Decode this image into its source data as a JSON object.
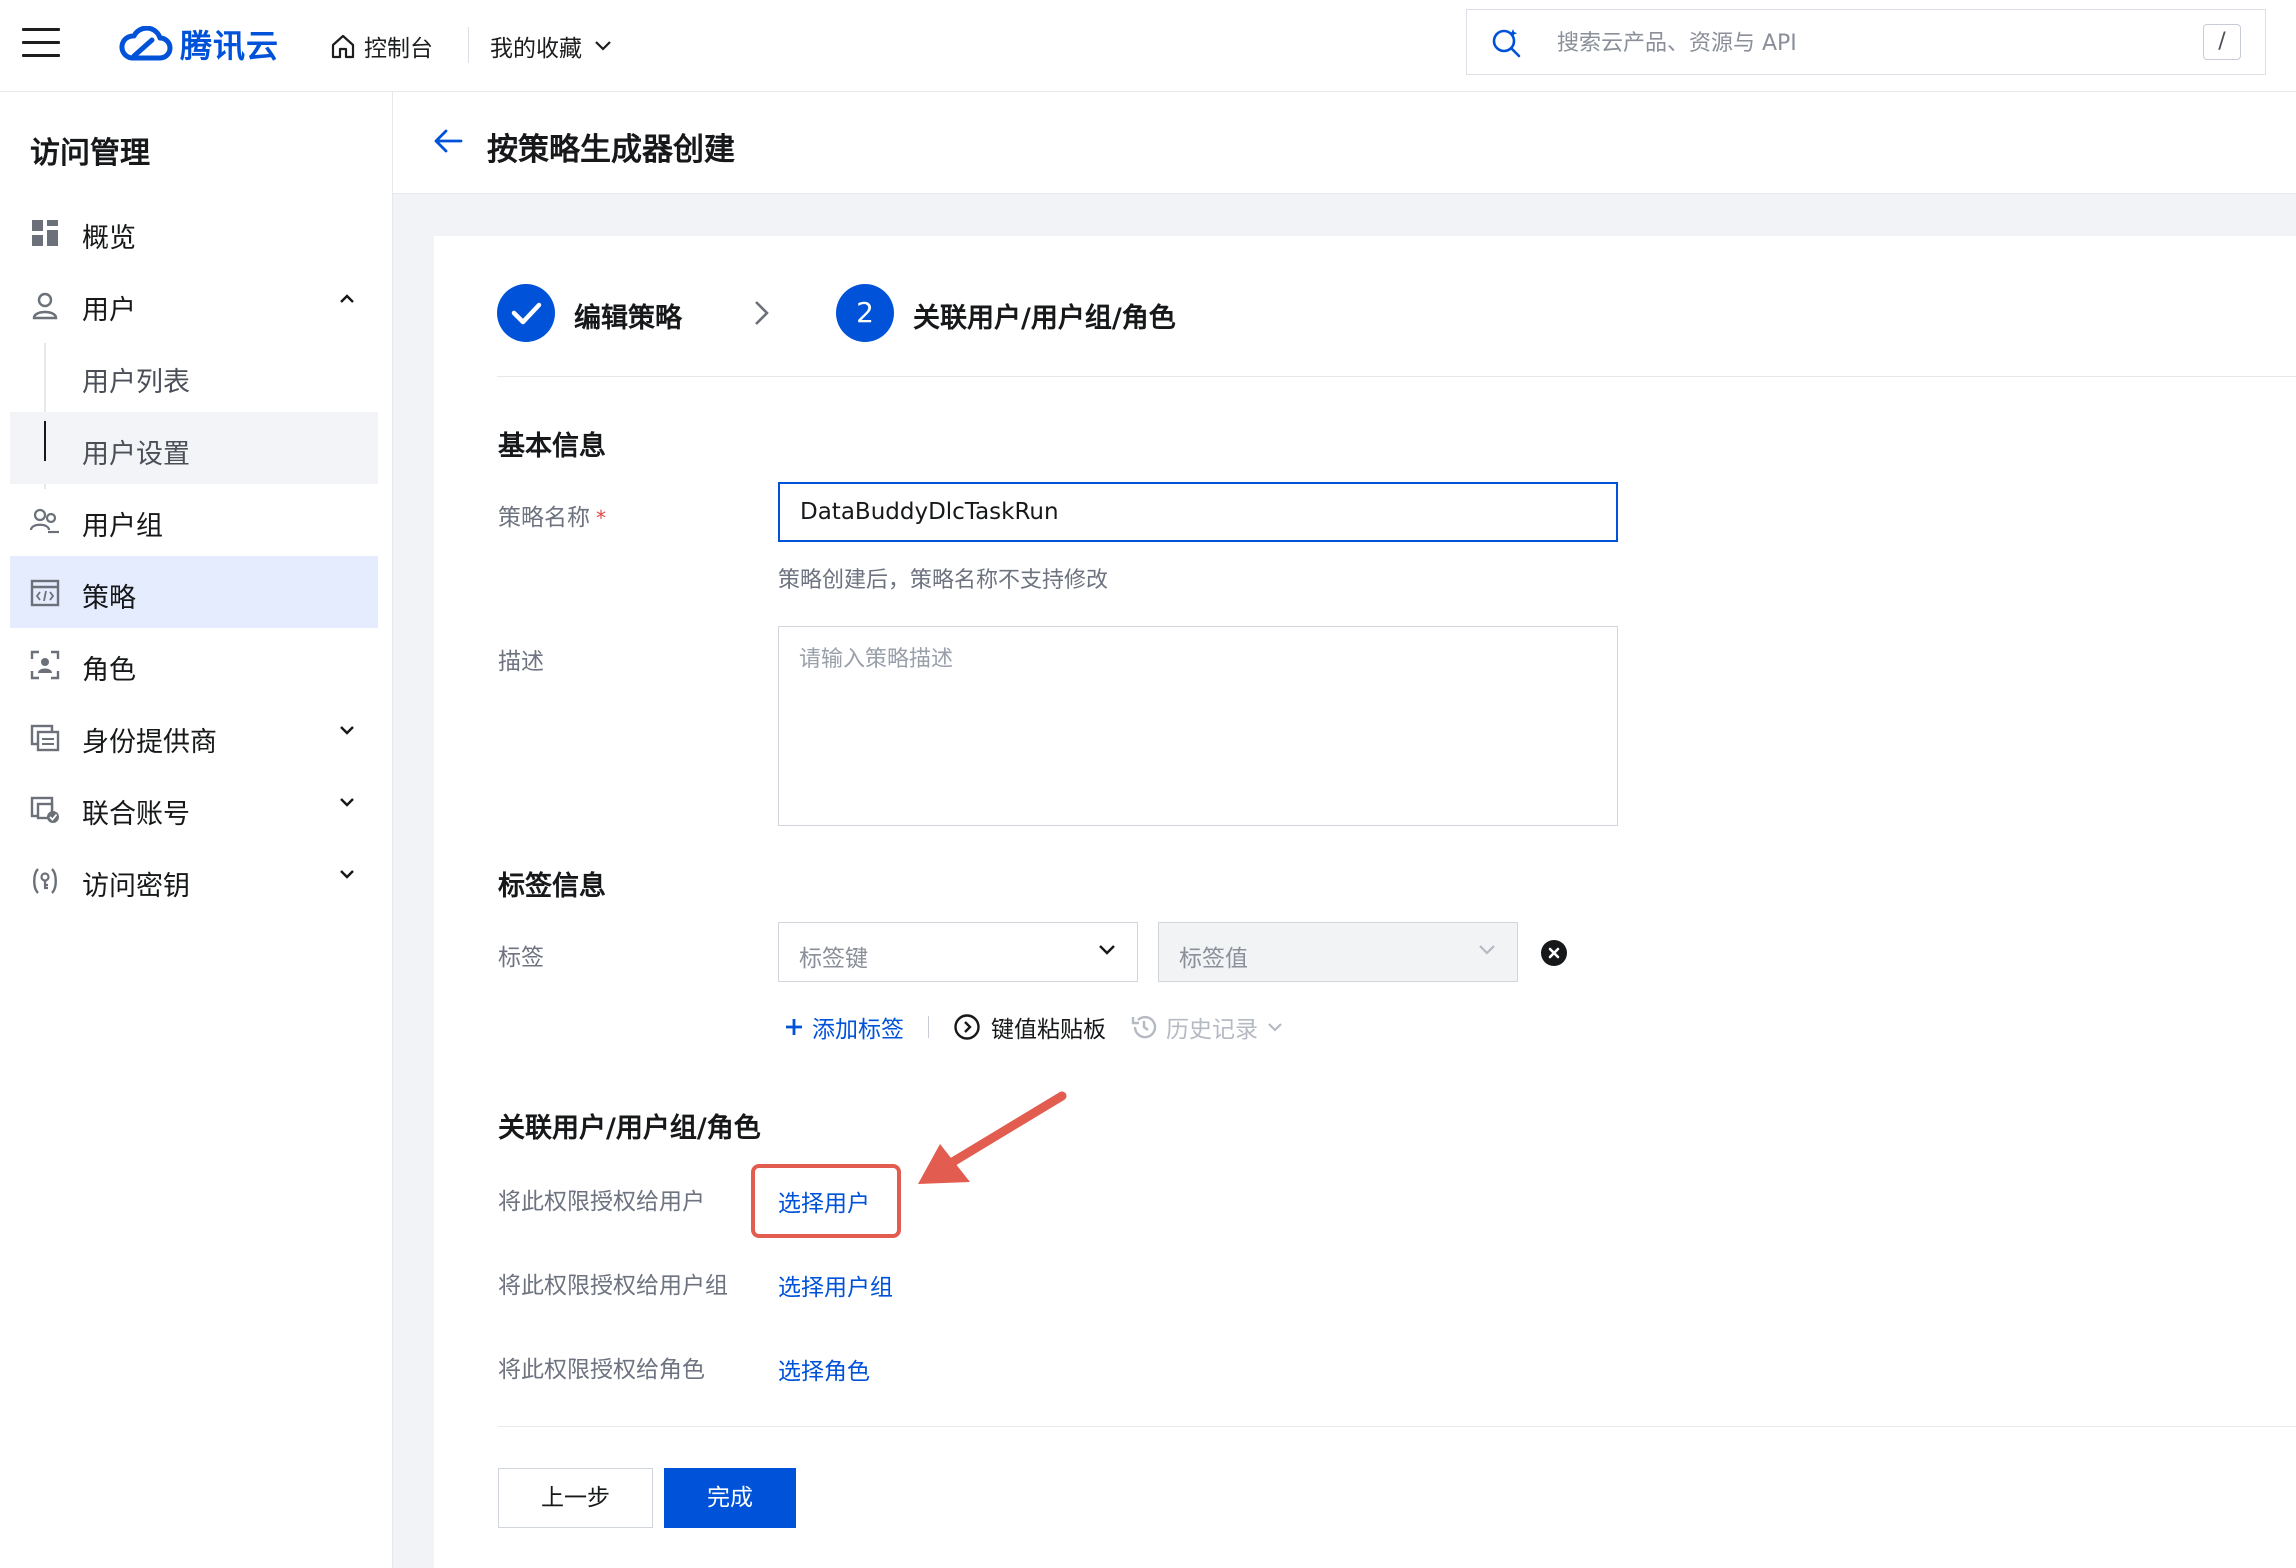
{
  "header": {
    "logo_text": "腾讯云",
    "console_label": "控制台",
    "favorites_label": "我的收藏",
    "search_placeholder": "搜索云产品、资源与 API",
    "search_shortcut": "/"
  },
  "sidebar": {
    "title": "访问管理",
    "items": [
      {
        "label": "概览",
        "icon": "grid-icon"
      },
      {
        "label": "用户",
        "icon": "user-icon",
        "expanded": true
      },
      {
        "label": "用户列表"
      },
      {
        "label": "用户设置",
        "selected": true
      },
      {
        "label": "用户组",
        "icon": "user-group-icon"
      },
      {
        "label": "策略",
        "icon": "policy-icon",
        "active": true
      },
      {
        "label": "角色",
        "icon": "role-icon"
      },
      {
        "label": "身份提供商",
        "icon": "identity-provider-icon"
      },
      {
        "label": "联合账号",
        "icon": "federated-account-icon"
      },
      {
        "label": "访问密钥",
        "icon": "access-key-icon"
      }
    ]
  },
  "page": {
    "title": "按策略生成器创建"
  },
  "steps": [
    {
      "label": "编辑策略",
      "state": "done"
    },
    {
      "number": "2",
      "label": "关联用户/用户组/角色",
      "state": "current"
    }
  ],
  "basic_info": {
    "section_title": "基本信息",
    "policy_name_label": "策略名称",
    "required_mark": "*",
    "policy_name_value": "DataBuddyDlcTaskRun",
    "policy_name_hint": "策略创建后，策略名称不支持修改",
    "description_label": "描述",
    "description_placeholder": "请输入策略描述"
  },
  "tag_info": {
    "section_title": "标签信息",
    "tag_label": "标签",
    "key_placeholder": "标签键",
    "value_placeholder": "标签值",
    "add_tag_label": "添加标签",
    "kv_paste_label": "键值粘贴板",
    "history_label": "历史记录"
  },
  "association": {
    "section_title": "关联用户/用户组/角色",
    "rows": [
      {
        "label": "将此权限授权给用户",
        "link": "选择用户"
      },
      {
        "label": "将此权限授权给用户组",
        "link": "选择用户组"
      },
      {
        "label": "将此权限授权给角色",
        "link": "选择角色"
      }
    ]
  },
  "footer": {
    "prev_label": "上一步",
    "finish_label": "完成"
  },
  "colors": {
    "brand": "#0052d9",
    "annotation": "#e25d4f",
    "active_nav_bg": "#e5ecfd"
  }
}
